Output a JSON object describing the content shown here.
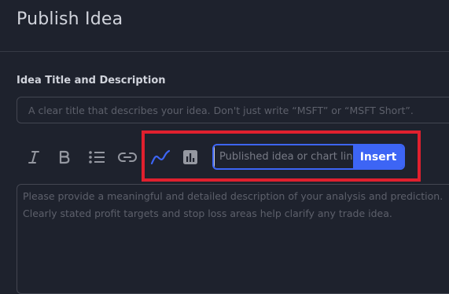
{
  "header": {
    "title": "Publish Idea"
  },
  "form": {
    "section_label": "Idea Title and Description",
    "title_placeholder": "A clear title that describes your idea. Don't just write “MSFT” or “MSFT Short”.",
    "description_placeholder": "Please provide a meaningful and detailed description of your analysis and prediction.\nClearly stated profit targets and stop loss areas help clarify any trade idea."
  },
  "toolbar": {
    "icons": [
      "italic-icon",
      "bold-icon",
      "bulleted-list-icon",
      "link-icon",
      "chart-line-icon",
      "bar-chart-icon"
    ],
    "active_icon": "chart-line-icon",
    "embed": {
      "placeholder": "Published idea or chart link",
      "insert_label": "Insert"
    }
  },
  "colors": {
    "background": "#1e222d",
    "accent": "#3d65f5",
    "highlight": "#e0202e",
    "text": "#d1d4dc",
    "muted": "#787b86"
  }
}
